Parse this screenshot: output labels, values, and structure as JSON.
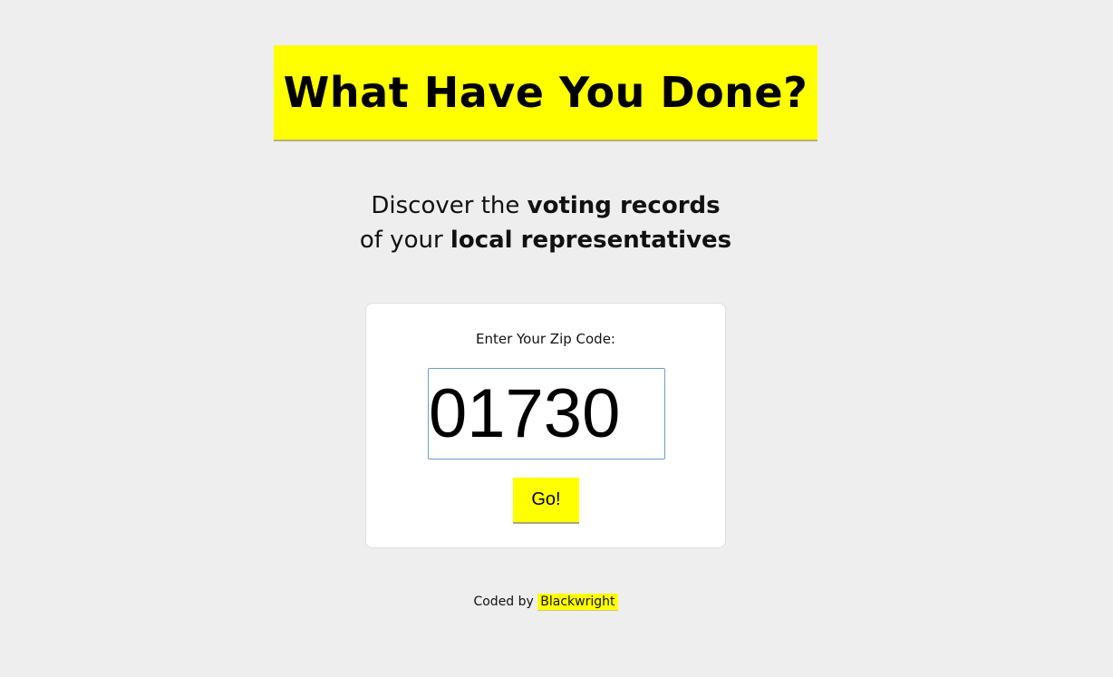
{
  "header": {
    "title": "What Have You Done?"
  },
  "tagline": {
    "line1_prefix": "Discover the ",
    "line1_bold": "voting records",
    "line2_prefix": "of your ",
    "line2_bold": "local representatives"
  },
  "form": {
    "zip_label": "Enter Your Zip Code:",
    "zip_value": "01730",
    "submit_label": "Go!"
  },
  "footer": {
    "prefix": "Coded by",
    "author_link": "Blackwright"
  },
  "colors": {
    "accent": "#ffff00",
    "background": "#eeeeee",
    "card": "#ffffff"
  }
}
